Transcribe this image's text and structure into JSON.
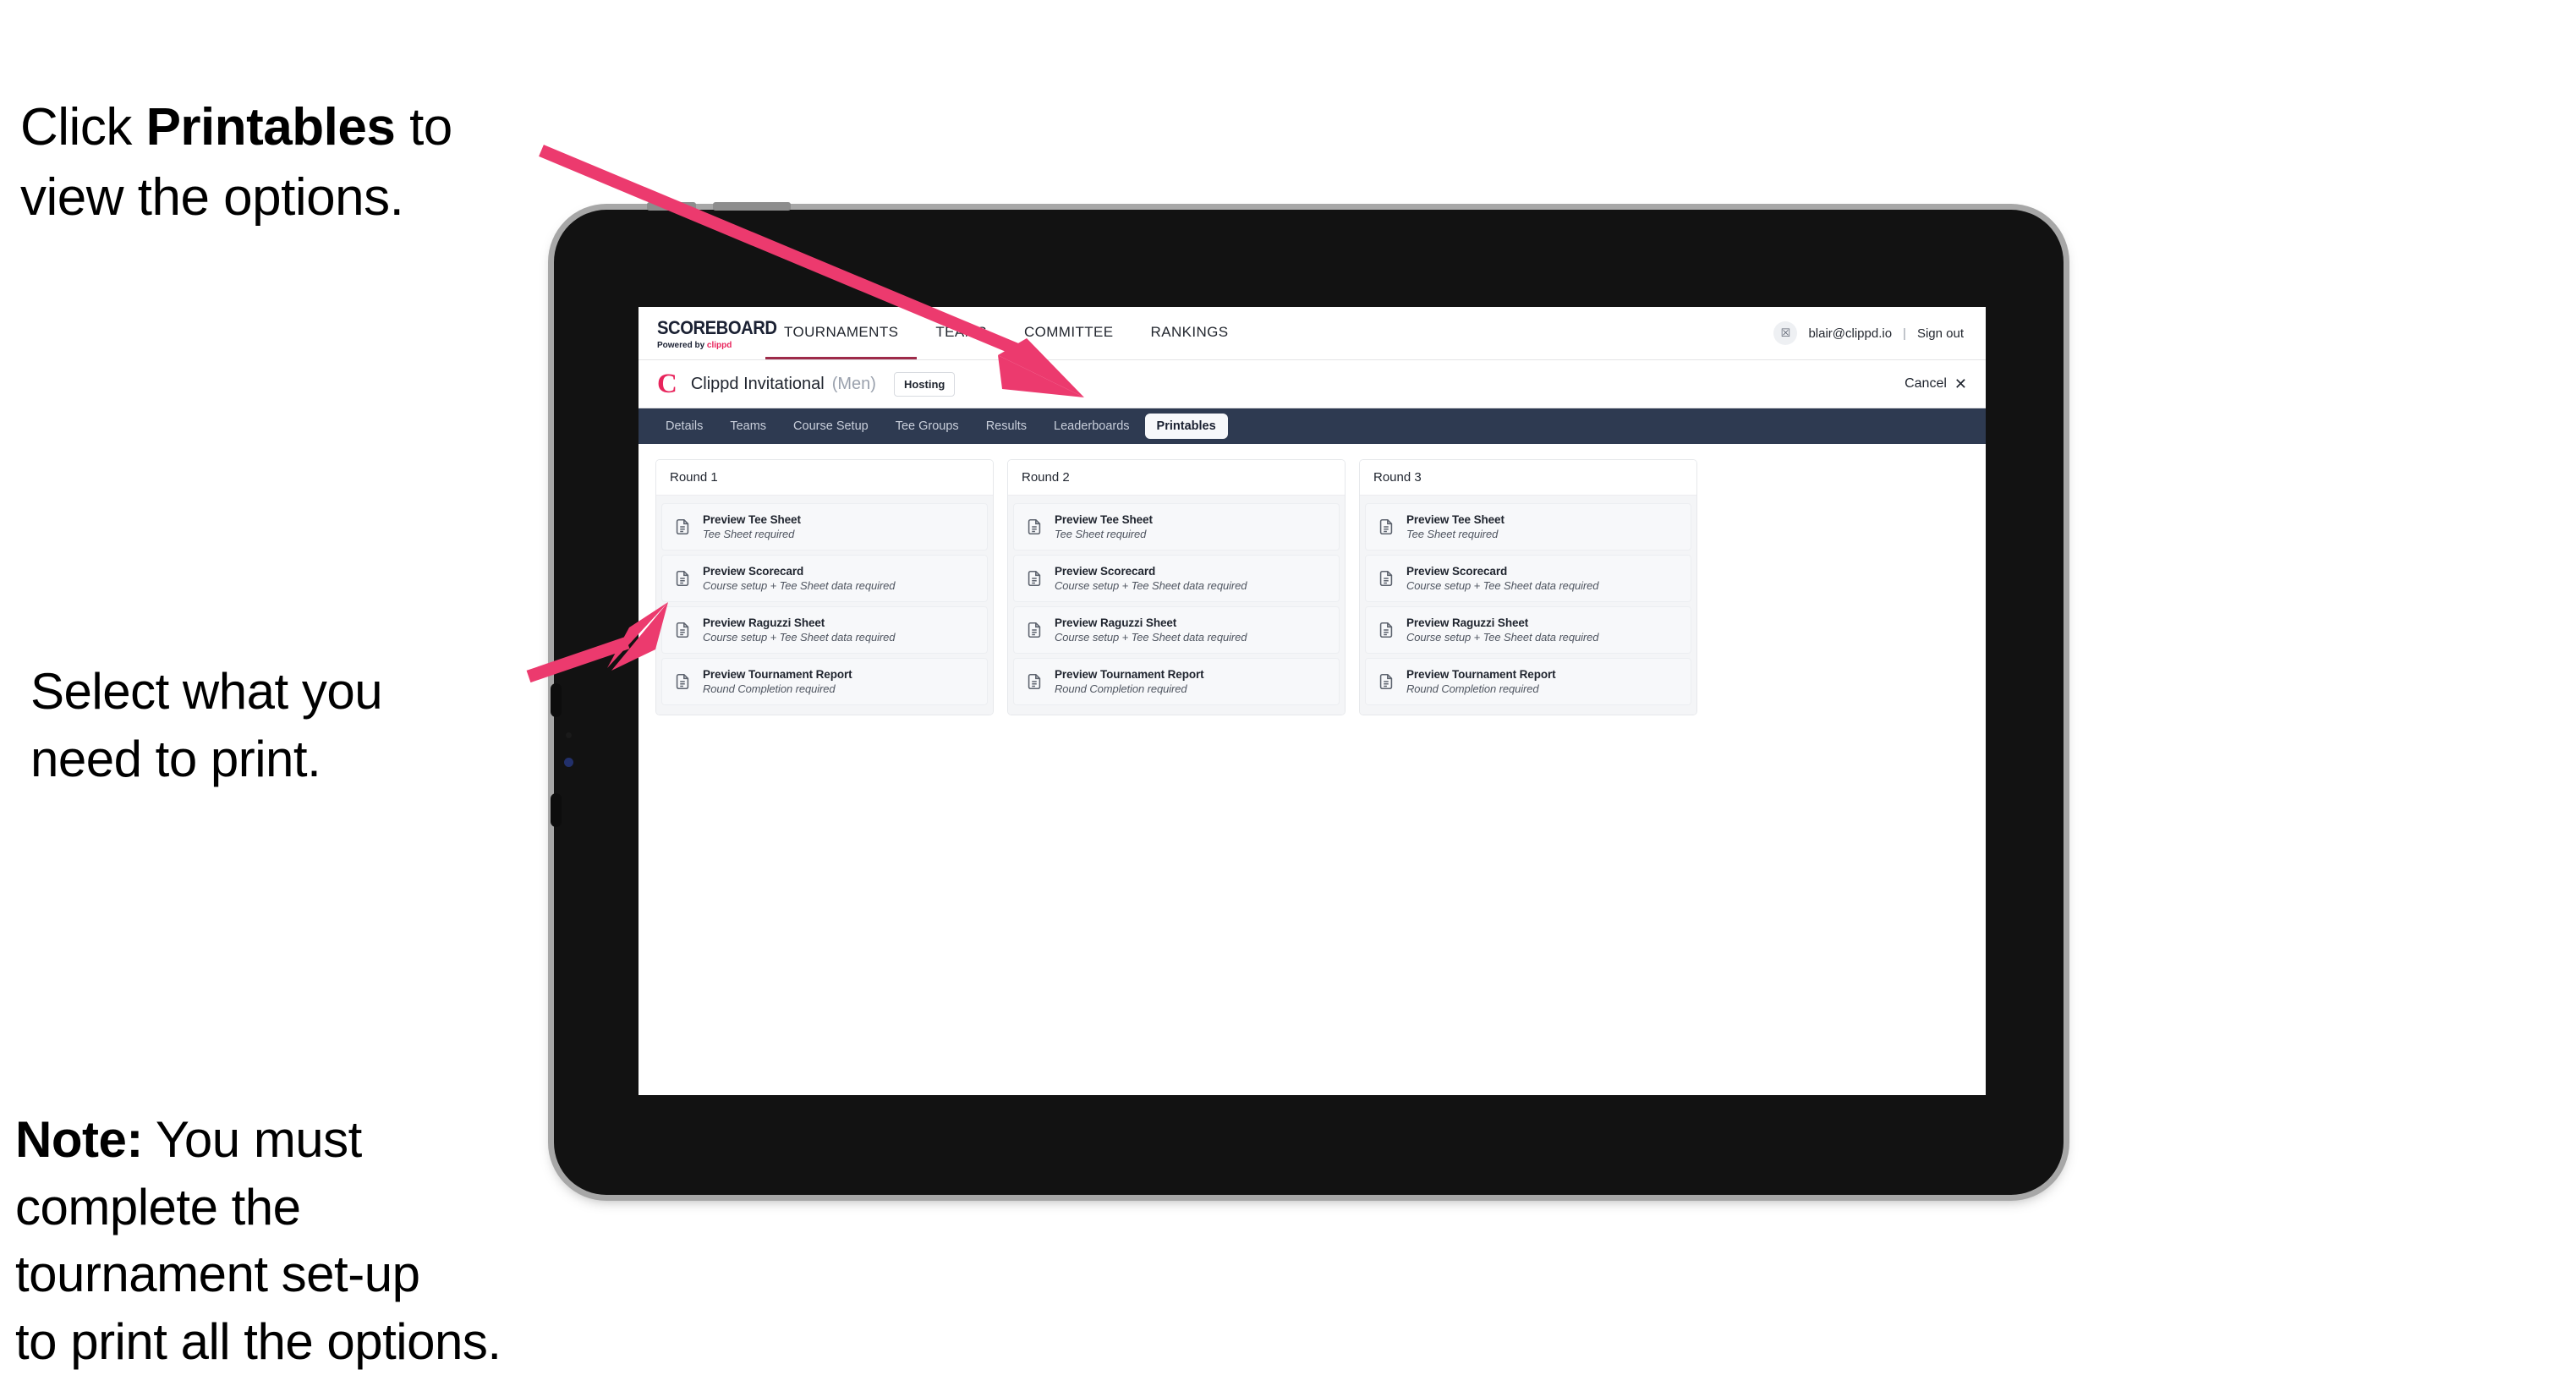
{
  "annotations": {
    "top": {
      "prefix": "Click ",
      "bold": "Printables",
      "suffix": " to\nview the options."
    },
    "middle": {
      "text": "Select what you\n need to print."
    },
    "note": {
      "bold": "Note:",
      "text": " You must\ncomplete the\ntournament set-up\nto print all the options."
    }
  },
  "app": {
    "logo": {
      "word": "SCOREBOARD",
      "powered_by": "Powered by ",
      "brand": "clippd"
    },
    "main_nav": [
      {
        "label": "TOURNAMENTS",
        "active": true
      },
      {
        "label": "TEAMS",
        "active": false
      },
      {
        "label": "COMMITTEE",
        "active": false
      },
      {
        "label": "RANKINGS",
        "active": false
      }
    ],
    "account": {
      "avatar_initial": "☒",
      "email": "blair@clippd.io",
      "separator": "|",
      "sign_out": "Sign out"
    },
    "tournament": {
      "logo_mark": "C",
      "name": "Clippd Invitational",
      "gender": "(Men)",
      "status_badge": "Hosting",
      "cancel_label": "Cancel",
      "cancel_icon": "✕"
    },
    "tabs": [
      {
        "label": "Details",
        "active": false
      },
      {
        "label": "Teams",
        "active": false
      },
      {
        "label": "Course Setup",
        "active": false
      },
      {
        "label": "Tee Groups",
        "active": false
      },
      {
        "label": "Results",
        "active": false
      },
      {
        "label": "Leaderboards",
        "active": false
      },
      {
        "label": "Printables",
        "active": true
      }
    ],
    "rounds": [
      {
        "title": "Round 1",
        "items": [
          {
            "title": "Preview Tee Sheet",
            "sub": "Tee Sheet required"
          },
          {
            "title": "Preview Scorecard",
            "sub": "Course setup + Tee Sheet data required"
          },
          {
            "title": "Preview Raguzzi Sheet",
            "sub": "Course setup + Tee Sheet data required"
          },
          {
            "title": "Preview Tournament Report",
            "sub": "Round Completion required"
          }
        ]
      },
      {
        "title": "Round 2",
        "items": [
          {
            "title": "Preview Tee Sheet",
            "sub": "Tee Sheet required"
          },
          {
            "title": "Preview Scorecard",
            "sub": "Course setup + Tee Sheet data required"
          },
          {
            "title": "Preview Raguzzi Sheet",
            "sub": "Course setup + Tee Sheet data required"
          },
          {
            "title": "Preview Tournament Report",
            "sub": "Round Completion required"
          }
        ]
      },
      {
        "title": "Round 3",
        "items": [
          {
            "title": "Preview Tee Sheet",
            "sub": "Tee Sheet required"
          },
          {
            "title": "Preview Scorecard",
            "sub": "Course setup + Tee Sheet data required"
          },
          {
            "title": "Preview Raguzzi Sheet",
            "sub": "Course setup + Tee Sheet data required"
          },
          {
            "title": "Preview Tournament Report",
            "sub": "Round Completion required"
          }
        ]
      }
    ]
  },
  "colors": {
    "accent_pink": "#e8245c",
    "arrow_pink": "#ec3a6e",
    "tabstrip_dark": "#2e3a51",
    "nav_active_underline": "#9e2b4a"
  }
}
